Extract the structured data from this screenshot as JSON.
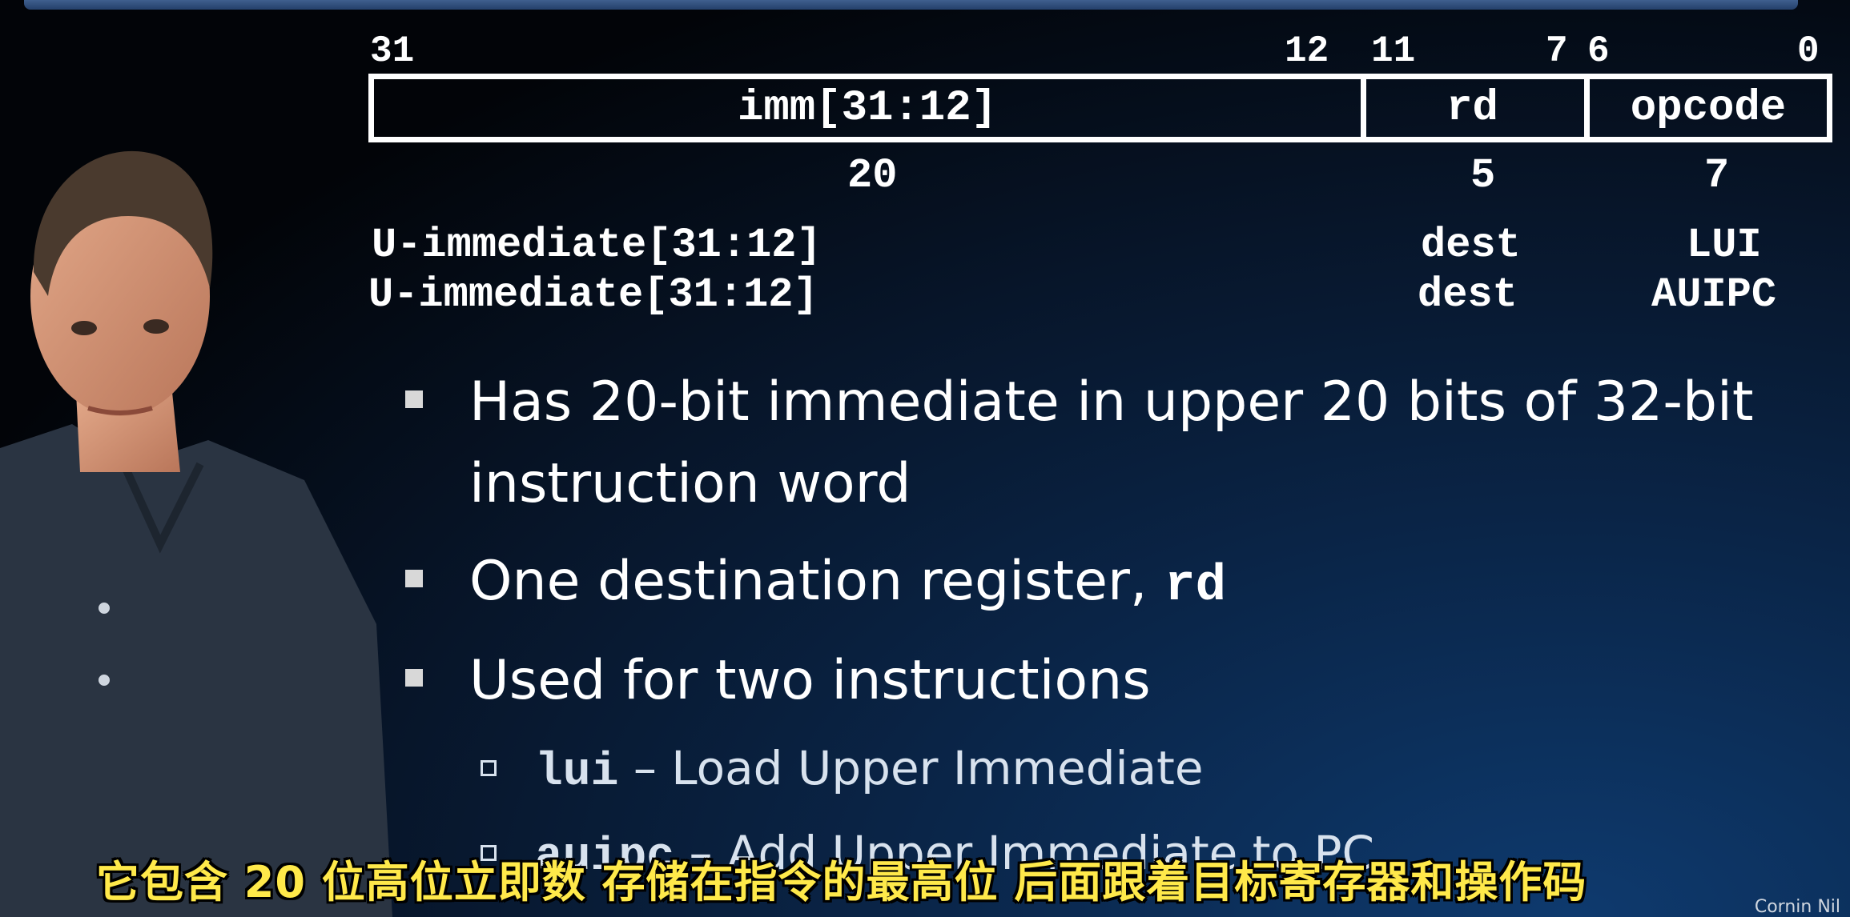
{
  "format": {
    "bit_labels": [
      "31",
      "12",
      "11",
      "7",
      "6",
      "0"
    ],
    "fields": [
      {
        "name": "imm[31:12]",
        "width": "20"
      },
      {
        "name": "rd",
        "width": "5"
      },
      {
        "name": "opcode",
        "width": "7"
      }
    ],
    "rows": [
      {
        "imm": "U-immediate[31:12]",
        "rd": "dest",
        "opcode": "LUI"
      },
      {
        "imm": "U-immediate[31:12]",
        "rd": "dest",
        "opcode": "AUIPC"
      }
    ]
  },
  "bullets": [
    {
      "line1": "Has 20-bit immediate in upper 20 bits of 32-bit",
      "line2": "instruction word"
    },
    {
      "text": "One destination register, ",
      "code": "rd"
    },
    {
      "text": "Used for two instructions"
    }
  ],
  "sub_bullets": [
    {
      "code": "lui",
      "text": " – Load  Upper Immediate"
    },
    {
      "code": "auipc",
      "text": " – Add Upper Immediate to PC"
    }
  ],
  "subtitle": "它包含 20 位高位立即数 存储在指令的最高位 后面跟着目标寄存器和操作码",
  "watermark": "Cornin Nil",
  "colors": {
    "subtitle": "#ffe94a",
    "text": "#ffffff",
    "background": "#071529"
  }
}
